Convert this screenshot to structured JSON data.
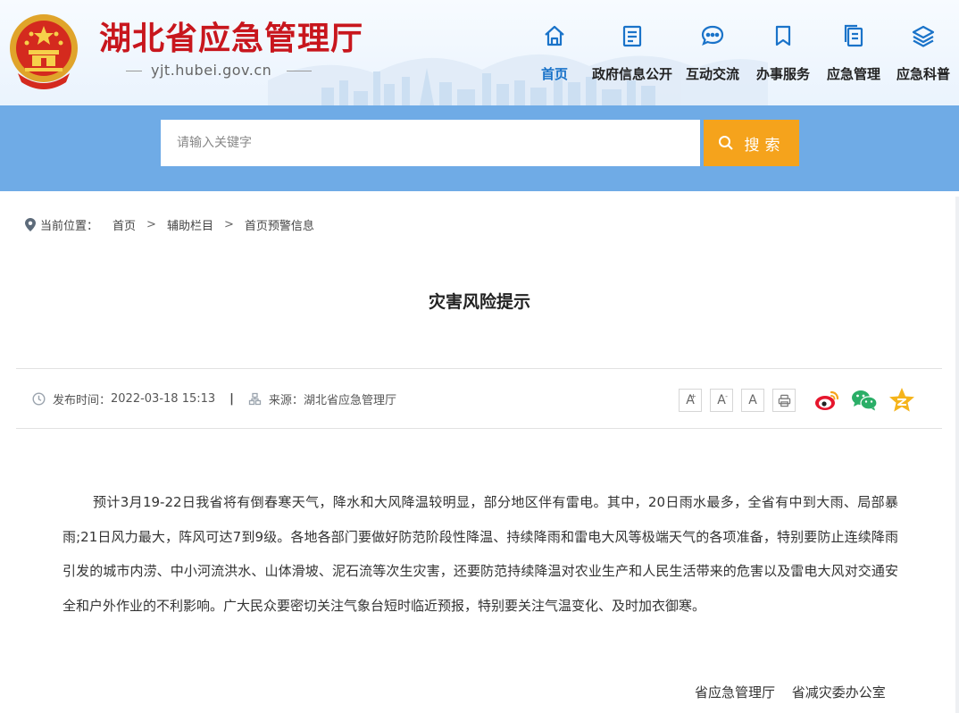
{
  "header": {
    "site_title": "湖北省应急管理厅",
    "domain": "yjt.hubei.gov.cn",
    "nav": [
      {
        "label": "首页",
        "icon": "home-icon",
        "active": true
      },
      {
        "label": "政府信息公开",
        "icon": "document-icon",
        "active": false
      },
      {
        "label": "互动交流",
        "icon": "chat-icon",
        "active": false
      },
      {
        "label": "办事服务",
        "icon": "bookmark-icon",
        "active": false
      },
      {
        "label": "应急管理",
        "icon": "files-icon",
        "active": false
      },
      {
        "label": "应急科普",
        "icon": "layers-icon",
        "active": false
      }
    ]
  },
  "search": {
    "placeholder": "请输入关键字",
    "button_label": "搜索"
  },
  "breadcrumb": {
    "label": "当前位置：",
    "items": [
      "首页",
      "辅助栏目",
      "首页预警信息"
    ]
  },
  "article": {
    "title": "灾害风险提示",
    "publish_label": "发布时间：",
    "publish_time": "2022-03-18 15:13",
    "source_label": "来源：",
    "source": "湖北省应急管理厅",
    "font_buttons": [
      "A",
      "A",
      "A"
    ],
    "body": "预计3月19-22日我省将有倒春寒天气，降水和大风降温较明显，部分地区伴有雷电。其中，20日雨水最多，全省有中到大雨、局部暴雨;21日风力最大，阵风可达7到9级。各地各部门要做好防范阶段性降温、持续降雨和雷电大风等极端天气的各项准备，特别要防止连续降雨引发的城市内涝、中小河流洪水、山体滑坡、泥石流等次生灾害，还要防范持续降温对农业生产和人民生活带来的危害以及雷电大风对交通安全和户外作业的不利影响。广大民众要密切关注气象台短时临近预报，特别要关注气温变化、及时加衣御寒。",
    "signature": "省应急管理厅 省减灾委办公室"
  },
  "colors": {
    "title_red": "#c8161d",
    "nav_active": "#1a73c9",
    "search_band": "#6fabe6",
    "search_button": "#f5a31c"
  }
}
